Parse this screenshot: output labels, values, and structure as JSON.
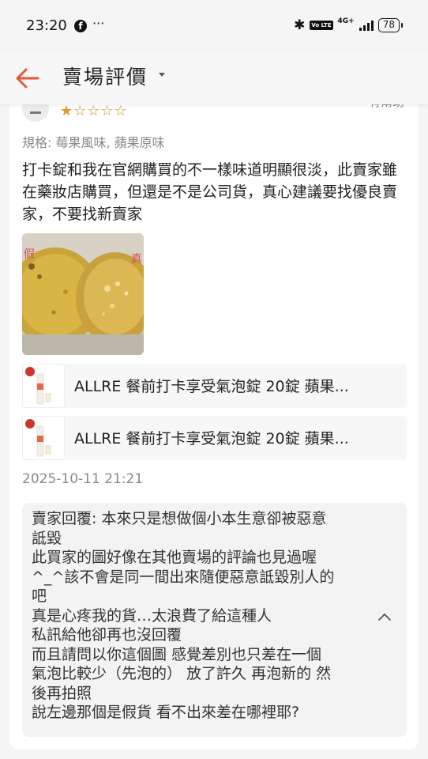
{
  "status": {
    "time": "23:20",
    "more": "···",
    "network": "4G+",
    "volte": "Vo LTE",
    "battery": "78"
  },
  "header": {
    "title": "賣場評價"
  },
  "review": {
    "stars_filled": "★",
    "stars_empty": "☆☆☆☆",
    "rating": 1,
    "likes": "有幫助",
    "spec": "規格: 莓果風味, 蘋果原味",
    "text": "打卡錠和我在官網購買的不一樣味道明顯很淡，此賣家雖在藥妝店購買，但還是不是公司貨，真心建議要找優良賣家，不要找新賣家",
    "photo_labels": {
      "left": "假",
      "right": "真"
    },
    "products": [
      {
        "name": "ALLRE 餐前打卡享受氣泡錠 20錠 蘋果..."
      },
      {
        "name": "ALLRE 餐前打卡享受氣泡錠 20錠 蘋果..."
      }
    ],
    "date": "2025-10-11 21:21",
    "reply_lines": [
      "賣家回覆: 本來只是想做個小本生意卻被惡意",
      "詆毀",
      "此買家的圖好像在其他賣場的評論也見過喔",
      "^_^該不會是同一間出來隨便惡意詆毀別人的",
      "吧",
      "真是心疼我的貨…太浪費了給這種人",
      "私訊給他卻再也沒回覆",
      "而且請問以你這個圖 感覺差別也只差在一個",
      "氣泡比較少（先泡的） 放了許久 再泡新的 然",
      "後再拍照",
      "說左邊那個是假貨 看不出來差在哪裡耶?"
    ]
  },
  "colors": {
    "accent": "#e05a3a",
    "star": "#e29a1e"
  },
  "icons": {
    "back": "back-arrow-icon",
    "caret": "caret-down-icon",
    "collapse": "chevron-up-icon"
  }
}
